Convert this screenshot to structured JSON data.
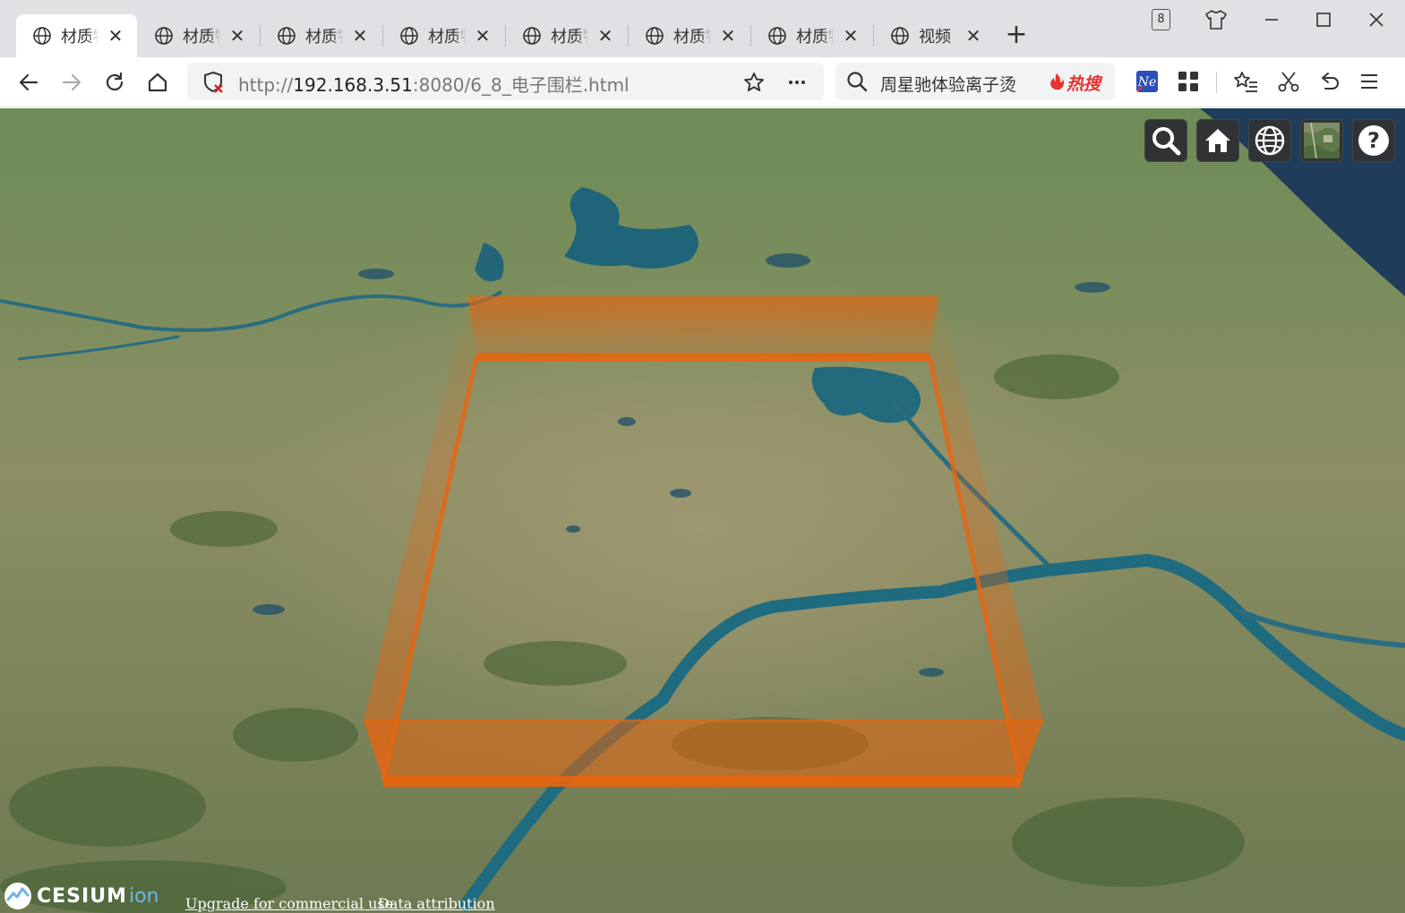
{
  "browser": {
    "tabs": [
      {
        "title": "材质物",
        "active": true
      },
      {
        "title": "材质物",
        "active": false
      },
      {
        "title": "材质物",
        "active": false
      },
      {
        "title": "材质物",
        "active": false
      },
      {
        "title": "材质物",
        "active": false
      },
      {
        "title": "材质物",
        "active": false
      },
      {
        "title": "材质物",
        "active": false
      },
      {
        "title": "视频",
        "active": false
      }
    ],
    "tab_close_glyph": "✕",
    "new_tab_glyph": "+",
    "window_badge_count": "8",
    "url": {
      "scheme": "http://",
      "host": "192.168.3.51",
      "rest": ":8080/6_8_电子围栏.html"
    },
    "search": {
      "query": "周星驰体验离子烫",
      "hot_label": "热搜"
    },
    "icons": {
      "back": "back-arrow-icon",
      "forward": "forward-arrow-icon",
      "reload": "reload-icon",
      "home": "home-icon",
      "security": "insecure-shield-icon",
      "bookmark": "star-icon",
      "more": "more-dots-icon",
      "search": "search-icon"
    }
  },
  "cesium": {
    "toolbar": [
      {
        "name": "geocoder-search-button",
        "icon": "search-icon"
      },
      {
        "name": "home-view-button",
        "icon": "home-icon"
      },
      {
        "name": "scene-mode-button",
        "icon": "globe-icon"
      },
      {
        "name": "base-layer-picker-button",
        "icon": "imagery-thumbnail-icon"
      },
      {
        "name": "navigation-help-button",
        "icon": "help-icon"
      }
    ],
    "logo_text": "CESIUM",
    "logo_suffix": "ion",
    "credit_upgrade": "Upgrade for commercial use.",
    "credit_attribution": "Data attribution",
    "fence_color": "#e8650f"
  }
}
